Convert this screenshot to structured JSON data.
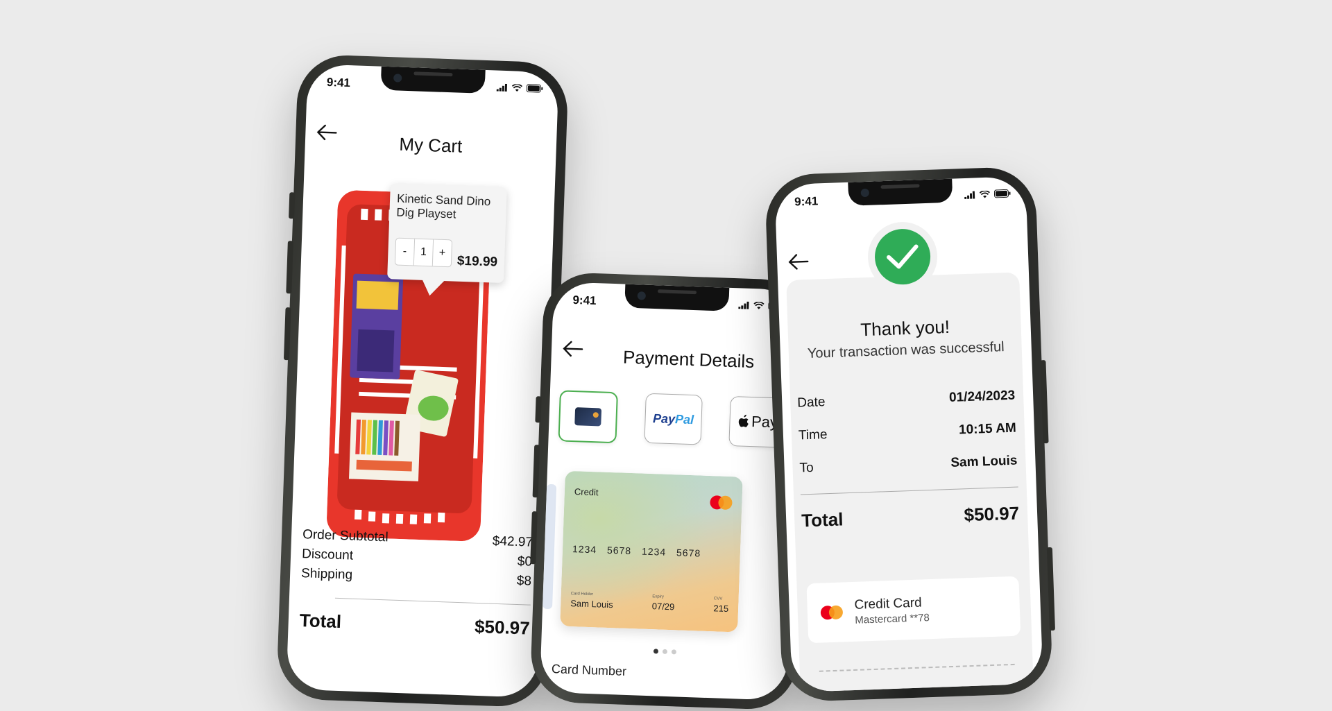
{
  "cart_screen": {
    "status_time": "9:41",
    "title": "My Cart",
    "product": {
      "name": "Kinetic Sand Dino Dig Playset",
      "quantity": "1",
      "decrement": "-",
      "increment": "+",
      "price": "$19.99"
    },
    "summary": {
      "rows": [
        {
          "label": "Order Subtotal",
          "value": "$42.97"
        },
        {
          "label": "Discount",
          "value": "$0"
        },
        {
          "label": "Shipping",
          "value": "$8"
        }
      ],
      "total_label": "Total",
      "total_value": "$50.97"
    }
  },
  "payment_screen": {
    "status_time": "9:41",
    "title": "Payment Details",
    "methods": {
      "paypal_a": "Pay",
      "paypal_b": "Pal",
      "applepay": "Pay"
    },
    "card": {
      "type": "Credit",
      "number": "1234 5678 1234 5678",
      "holder_label": "Card Holder",
      "holder": "Sam Louis",
      "expiry_label": "Expiry",
      "expiry": "07/29",
      "cvv_label": "CVV",
      "cvv": "215"
    },
    "field_label": "Card Number"
  },
  "success_screen": {
    "status_time": "9:41",
    "heading": "Thank you!",
    "subheading": "Your transaction was successful",
    "details": [
      {
        "label": "Date",
        "value": "01/24/2023"
      },
      {
        "label": "Time",
        "value": "10:15 AM"
      },
      {
        "label": "To",
        "value": "Sam Louis"
      }
    ],
    "total_label": "Total",
    "total_value": "$50.97",
    "payment_method": {
      "title": "Credit Card",
      "subtitle": "Mastercard **78"
    }
  },
  "colors": {
    "background": "#ebebeb",
    "success_green": "#2fac57",
    "basket_red": "#e8362b",
    "active_border": "#4caf50"
  }
}
